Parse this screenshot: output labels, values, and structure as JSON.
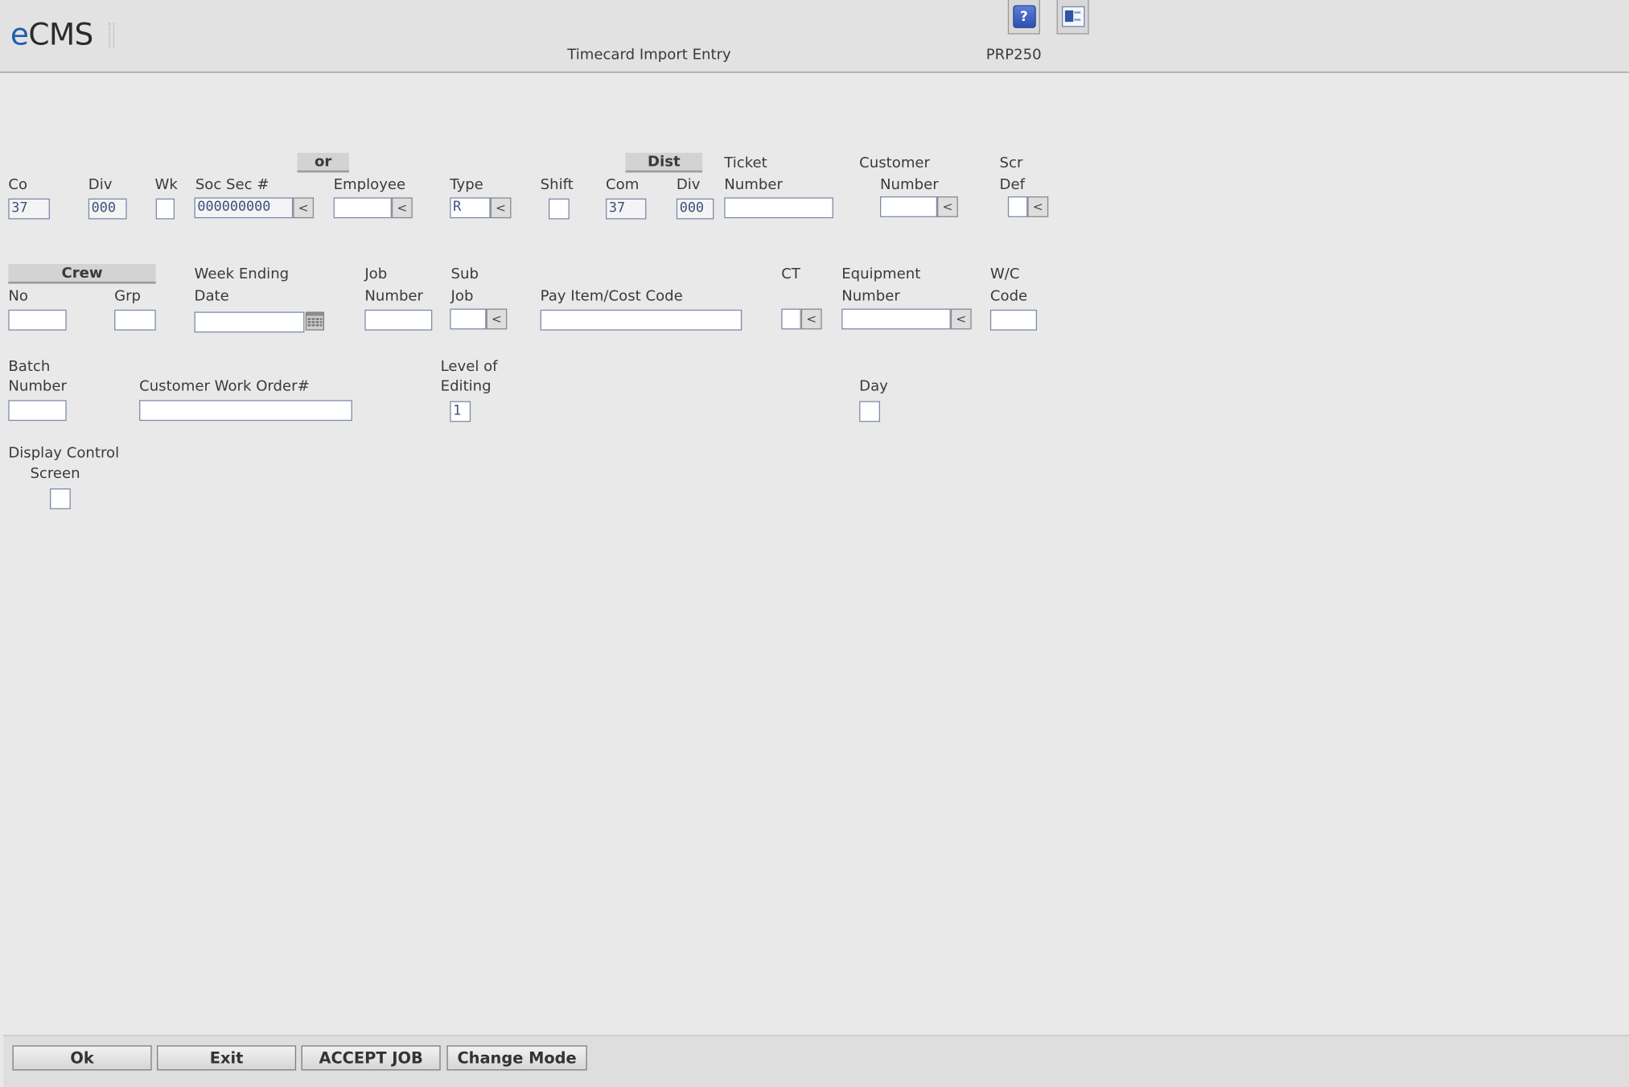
{
  "header": {
    "logo_prefix": "e",
    "logo_rest": "CMS",
    "title": "Timecard Import Entry",
    "program": "PRP250",
    "help_icon": "help-icon",
    "export_icon": "excel-export-icon"
  },
  "sections": {
    "or": "or",
    "dist": "Dist",
    "crew": "Crew"
  },
  "row1": {
    "co_label": "Co",
    "co_value": "37",
    "div_label": "Div",
    "div_value": "000",
    "wk_label": "Wk",
    "wk_value": "",
    "socsec_label": "Soc Sec #",
    "socsec_value": "000000000",
    "employee_label": "Employee",
    "employee_value": "",
    "type_label": "Type",
    "type_value": "R",
    "shift_label": "Shift",
    "shift_value": "",
    "com_label": "Com",
    "com_value": "37",
    "dist_div_label": "Div",
    "dist_div_value": "000",
    "ticket_label1": "Ticket",
    "ticket_label2": "Number",
    "ticket_value": "",
    "customer_label1": "Customer",
    "customer_label2": "Number",
    "customer_value": "",
    "scr_label1": "Scr",
    "scr_label2": "Def",
    "scr_value": ""
  },
  "row2": {
    "crew_no_label": "No",
    "crew_no_value": "",
    "crew_grp_label": "Grp",
    "crew_grp_value": "",
    "week_label1": "Week Ending",
    "week_label2": "Date",
    "week_value": "",
    "job_label1": "Job",
    "job_label2": "Number",
    "job_value": "",
    "subjob_label1": "Sub",
    "subjob_label2": "Job",
    "subjob_value": "",
    "payitem_label": "Pay Item/Cost Code",
    "payitem_value": "",
    "ct_label": "CT",
    "ct_value": "",
    "equip_label1": "Equipment",
    "equip_label2": "Number",
    "equip_value": "",
    "wc_label1": "W/C",
    "wc_label2": "Code",
    "wc_value": ""
  },
  "row3": {
    "batch_label1": "Batch",
    "batch_label2": "Number",
    "batch_value": "",
    "cwo_label": "Customer Work Order#",
    "cwo_value": "",
    "level_label1": "Level of",
    "level_label2": "Editing",
    "level_value": "1",
    "day_label": "Day"
  },
  "row4": {
    "display_label1": "Display Control",
    "display_label2": "Screen"
  },
  "lookup_glyph": "<",
  "footer": {
    "ok": "Ok",
    "exit": "Exit",
    "accept_job": "ACCEPT JOB",
    "change_mode": "Change Mode"
  }
}
